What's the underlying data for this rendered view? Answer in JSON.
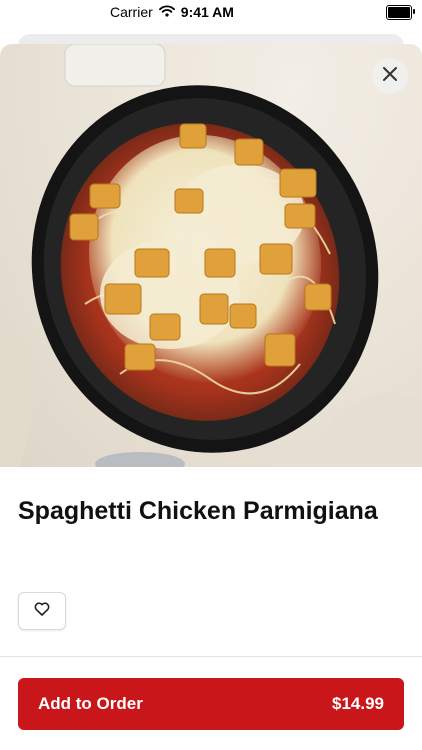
{
  "status_bar": {
    "carrier": "Carrier",
    "time": "9:41 AM"
  },
  "item": {
    "title": "Spaghetti Chicken Parmigiana",
    "image_icon": "food-photo"
  },
  "actions": {
    "close_icon": "close-icon",
    "favorite_icon": "heart-icon",
    "add_label": "Add to Order",
    "price": "$14.99"
  },
  "colors": {
    "accent": "#c8161b",
    "background": "#ffffff"
  }
}
